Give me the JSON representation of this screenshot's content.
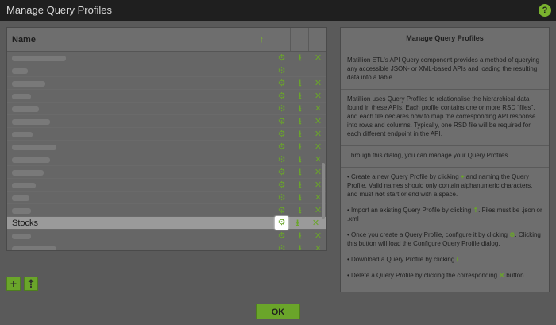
{
  "window": {
    "title": "Manage Query Profiles",
    "help_label": "?"
  },
  "table": {
    "header_name": "Name",
    "sort_icon": "sort-ascending-icon",
    "rows": [
      {
        "label": "",
        "blur_w": 68,
        "gear": true,
        "dl": true,
        "del": true
      },
      {
        "label": "",
        "blur_w": 20,
        "gear": true,
        "dl": false,
        "del": false
      },
      {
        "label": "",
        "blur_w": 42,
        "gear": true,
        "dl": true,
        "del": true
      },
      {
        "label": "",
        "blur_w": 24,
        "gear": true,
        "dl": true,
        "del": true
      },
      {
        "label": "",
        "blur_w": 34,
        "gear": true,
        "dl": true,
        "del": true
      },
      {
        "label": "",
        "blur_w": 48,
        "gear": true,
        "dl": true,
        "del": true
      },
      {
        "label": "",
        "blur_w": 26,
        "gear": true,
        "dl": true,
        "del": true
      },
      {
        "label": "",
        "blur_w": 56,
        "gear": true,
        "dl": true,
        "del": true
      },
      {
        "label": "",
        "blur_w": 48,
        "gear": true,
        "dl": true,
        "del": true
      },
      {
        "label": "",
        "blur_w": 40,
        "gear": true,
        "dl": true,
        "del": true
      },
      {
        "label": "",
        "blur_w": 30,
        "gear": true,
        "dl": true,
        "del": true
      },
      {
        "label": "",
        "blur_w": 22,
        "gear": true,
        "dl": true,
        "del": true
      },
      {
        "label": "",
        "blur_w": 24,
        "gear": true,
        "dl": true,
        "del": true
      },
      {
        "label": "Stocks",
        "blur_w": 0,
        "gear": true,
        "dl": true,
        "del": true,
        "selected": true
      },
      {
        "label": "",
        "blur_w": 24,
        "gear": true,
        "dl": true,
        "del": true
      },
      {
        "label": "",
        "blur_w": 56,
        "gear": true,
        "dl": true,
        "del": true
      },
      {
        "label": "",
        "blur_w": 92,
        "gear": true,
        "dl": true,
        "del": true
      }
    ]
  },
  "info": {
    "title": "Manage Query Profiles",
    "p1": "Matillion ETL's API Query component provides a method of querying any accessible JSON- or XML-based APIs and loading the resulting data into a table.",
    "p2": "Matillion uses Query Profiles to relationalise the hierarchical data found in these APIs. Each profile contains one or more RSD \"files\", and each file declares how to map the corresponding API response into rows and columns. Typically, one RSD file will be required for each different endpoint in the API.",
    "p3": "Through this dialog, you can manage your Query Profiles.",
    "b1a": "• Create a new Query Profile by clicking",
    "b1b": "and naming the Query Profile. Valid names should only contain alphanumeric characters, and must",
    "b1not": "not",
    "b1c": "start or end with a space.",
    "b2a": "• Import an existing Query Profile by clicking",
    "b2b": ". Files must be .json or .xml",
    "b3a": "• Once you create a Query Profile, configure it by clicking",
    "b3b": ". Clicking this button will load the Configure Query Profile dialog.",
    "b4a": "• Download a Query Profile by clicking",
    "b4b": ".",
    "b5a": "• Delete a Query Profile by clicking the corresponding",
    "b5b": "button."
  },
  "buttons": {
    "add": "+",
    "import": "⇡",
    "ok": "OK"
  },
  "colors": {
    "accent": "#6aa52a"
  }
}
